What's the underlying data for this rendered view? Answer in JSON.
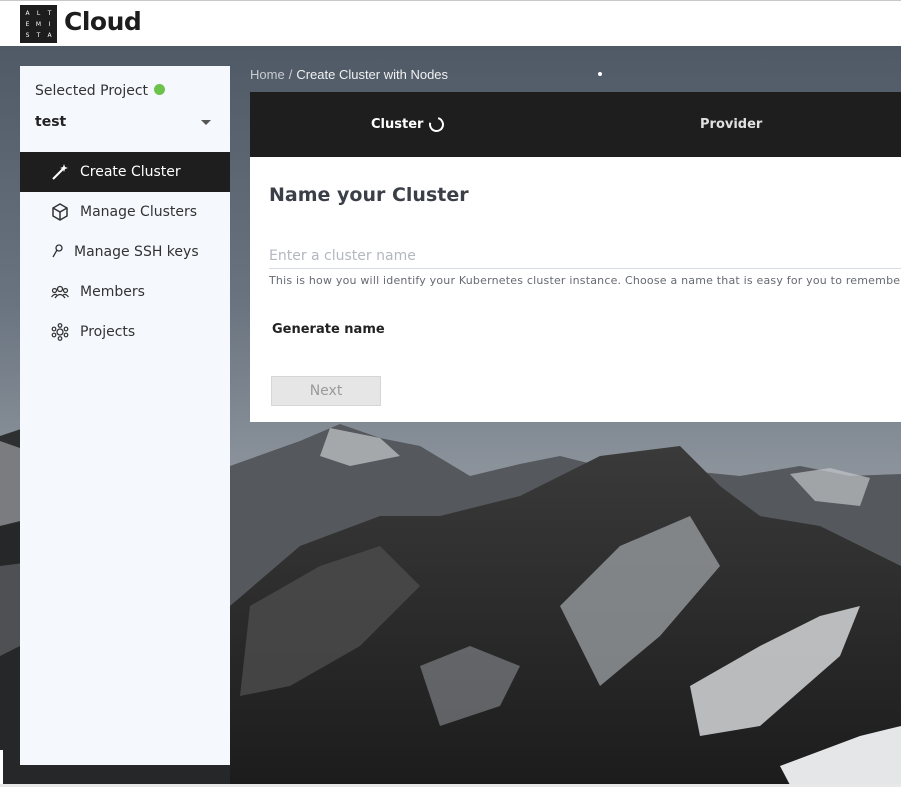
{
  "header": {
    "logo_letters": [
      "A",
      "L",
      "T",
      "E",
      "M",
      "I",
      "S",
      "T",
      "A"
    ],
    "logo_word": "Cloud"
  },
  "sidebar": {
    "project_label": "Selected Project",
    "project_status_color": "#6cc24a",
    "project_name": "test",
    "items": [
      {
        "label": "Create Cluster",
        "icon": "magic-wand-icon",
        "active": true
      },
      {
        "label": "Manage Clusters",
        "icon": "cube-icon",
        "active": false
      },
      {
        "label": "Manage SSH keys",
        "icon": "key-icon",
        "active": false
      },
      {
        "label": "Members",
        "icon": "members-icon",
        "active": false
      },
      {
        "label": "Projects",
        "icon": "projects-icon",
        "active": false
      }
    ]
  },
  "breadcrumb": {
    "home": "Home",
    "separator": "/",
    "current": "Create Cluster with Nodes"
  },
  "stepper": {
    "steps": [
      {
        "label": "Cluster",
        "state": "in-progress"
      },
      {
        "label": "Provider",
        "state": "pending"
      }
    ]
  },
  "form": {
    "title": "Name your Cluster",
    "name_placeholder": "Enter a cluster name",
    "name_value": "",
    "hint": "This is how you will identify your Kubernetes cluster instance. Choose a name that is easy for you to remembe",
    "generate_label": "Generate name",
    "next_label": "Next"
  },
  "colors": {
    "dark": "#1e1e1e",
    "sidebar_bg": "#f5f8fd",
    "status_green": "#6cc24a"
  }
}
